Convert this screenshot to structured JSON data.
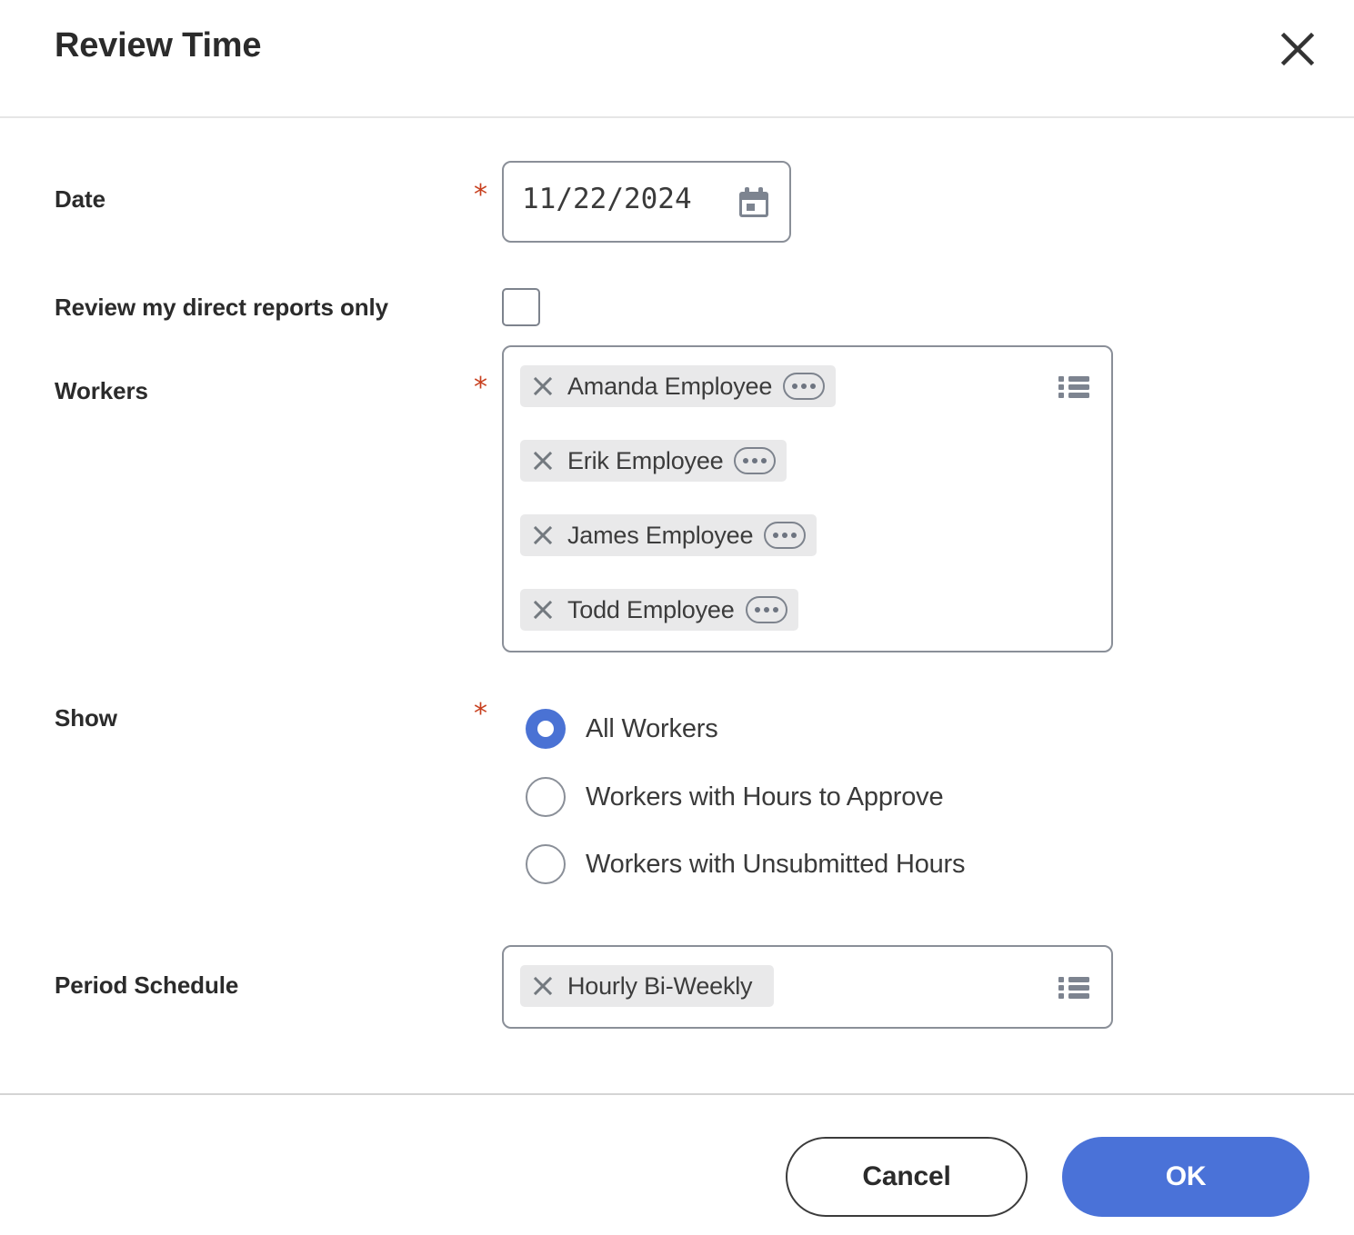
{
  "dialog": {
    "title": "Review Time",
    "close_icon": "close-icon"
  },
  "fields": {
    "date": {
      "label": "Date",
      "required_marker": "*",
      "value": "11/22/2024",
      "calendar_icon": "calendar-icon"
    },
    "direct_reports": {
      "label": "Review my direct reports only",
      "checked": false
    },
    "workers": {
      "label": "Workers",
      "required_marker": "*",
      "list_icon": "list-view-icon",
      "chips": [
        {
          "name": "Amanda Employee",
          "remove_icon": "close-icon",
          "more_icon": "ellipsis-icon"
        },
        {
          "name": "Erik Employee",
          "remove_icon": "close-icon",
          "more_icon": "ellipsis-icon"
        },
        {
          "name": "James Employee",
          "remove_icon": "close-icon",
          "more_icon": "ellipsis-icon"
        },
        {
          "name": "Todd Employee",
          "remove_icon": "close-icon",
          "more_icon": "ellipsis-icon"
        }
      ]
    },
    "show": {
      "label": "Show",
      "required_marker": "*",
      "options": [
        {
          "label": "All Workers",
          "selected": true
        },
        {
          "label": "Workers with Hours to Approve",
          "selected": false
        },
        {
          "label": "Workers with Unsubmitted Hours",
          "selected": false
        }
      ]
    },
    "period_schedule": {
      "label": "Period Schedule",
      "list_icon": "list-view-icon",
      "chips": [
        {
          "name": "Hourly Bi-Weekly",
          "remove_icon": "close-icon"
        }
      ]
    }
  },
  "footer": {
    "cancel_label": "Cancel",
    "ok_label": "OK"
  },
  "colors": {
    "accent_blue": "#4a72d8",
    "required_red": "#c8401f",
    "chip_bg": "#e9e9ea",
    "border_gray": "#8a8f98"
  }
}
